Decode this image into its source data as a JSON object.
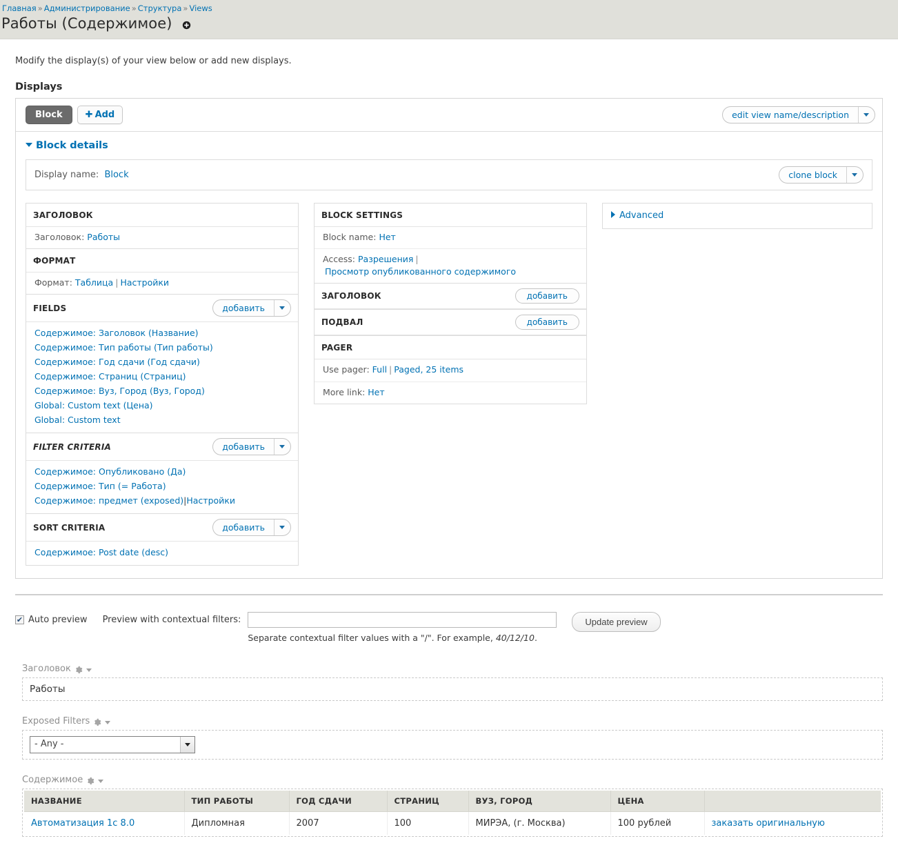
{
  "breadcrumb": [
    {
      "label": "Главная"
    },
    {
      "label": "Администрирование"
    },
    {
      "label": "Структура"
    },
    {
      "label": "Views"
    }
  ],
  "breadcrumb_separator": "»",
  "page_title": "Работы (Содержимое)",
  "help_text": "Modify the display(s) of your view below or add new displays.",
  "displays": {
    "section_label": "Displays",
    "tab_block": "Block",
    "add_button": "Add",
    "add_plus": "✚",
    "edit_view_button": "edit view name/description"
  },
  "block_details": {
    "title": "Block details",
    "display_name_label": "Display name:",
    "display_name_value": "Block",
    "clone_button": "clone block"
  },
  "left_column": {
    "title_bucket": {
      "heading": "ЗАГОЛОВОК",
      "label": "Заголовок:",
      "value": "Работы"
    },
    "format_bucket": {
      "heading": "ФОРМАТ",
      "label": "Формат:",
      "value": "Таблица",
      "separator": "|",
      "settings": "Настройки"
    },
    "fields_bucket": {
      "heading": "FIELDS",
      "add_button": "добавить",
      "items": [
        "Содержимое: Заголовок (Название)",
        "Содержимое: Тип работы (Тип работы)",
        "Содержимое: Год сдачи (Год сдачи)",
        "Содержимое: Страниц (Страниц)",
        "Содержимое: Вуз, Город (Вуз, Город)",
        "Global: Custom text (Цена)",
        "Global: Custom text"
      ]
    },
    "filter_bucket": {
      "heading": "FILTER CRITERIA",
      "add_button": "добавить",
      "items": [
        {
          "label": "Содержимое: Опубликовано (Да)",
          "settings": null
        },
        {
          "label": "Содержимое: Тип (= Работа)",
          "settings": null
        },
        {
          "label": "Содержимое: предмет (exposed)",
          "settings": "Настройки"
        }
      ]
    },
    "sort_bucket": {
      "heading": "SORT CRITERIA",
      "add_button": "добавить",
      "items": [
        "Содержимое: Post date (desc)"
      ]
    }
  },
  "mid_column": {
    "block_settings": {
      "heading": "BLOCK SETTINGS",
      "block_name_label": "Block name:",
      "block_name_value": "Нет",
      "access_label": "Access:",
      "access_value": "Разрешения",
      "access_separator": "|",
      "access_detail": "Просмотр опубликованного содержимого"
    },
    "header_bucket": {
      "heading": "ЗАГОЛОВОК",
      "add_button": "добавить"
    },
    "footer_bucket": {
      "heading": "ПОДВАЛ",
      "add_button": "добавить"
    },
    "pager_bucket": {
      "heading": "PAGER",
      "use_pager_label": "Use pager:",
      "use_pager_value": "Full",
      "separator": "|",
      "pager_detail": "Paged, 25 items",
      "more_link_label": "More link:",
      "more_link_value": "Нет"
    }
  },
  "right_column": {
    "advanced": "Advanced"
  },
  "preview": {
    "auto_preview_label": "Auto preview",
    "auto_preview_checked": true,
    "contextual_label": "Preview with contextual filters:",
    "contextual_value": "",
    "contextual_placeholder": "",
    "update_button": "Update preview",
    "hint_prefix": "Separate contextual filter values with a \"/\". For example, ",
    "hint_example": "40/12/10",
    "hint_suffix": ".",
    "header_section": {
      "title": "Заголовок",
      "content": "Работы"
    },
    "exposed_section": {
      "title": "Exposed Filters",
      "select_value": "- Any -"
    },
    "content_section": {
      "title": "Содержимое",
      "columns": [
        "НАЗВАНИЕ",
        "ТИП РАБОТЫ",
        "ГОД СДАЧИ",
        "СТРАНИЦ",
        "ВУЗ, ГОРОД",
        "ЦЕНА",
        ""
      ],
      "rows": [
        {
          "name": "Автоматизация 1с 8.0",
          "type": "Дипломная",
          "year": "2007",
          "pages": "100",
          "university": "МИРЭА, (г. Москва)",
          "price": "100 рублей",
          "order_link": "заказать оригинальную"
        }
      ]
    }
  },
  "colors": {
    "link": "#0071b3",
    "header_band": "#e0e0da",
    "tab_active": "#6b6b6b",
    "table_header": "#e3e3dc"
  }
}
